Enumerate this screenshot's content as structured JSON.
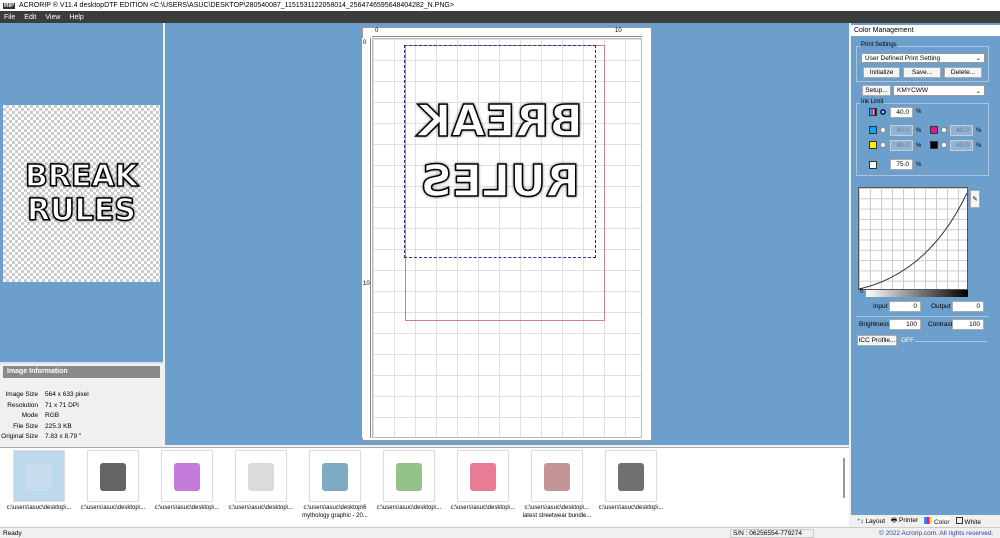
{
  "title": "ACRORIP ® V11.4 desktopDTF EDITION <C:\\USERS\\ASUC\\DESKTOP\\280540087_1151531122058014_2564746595648404282_N.PNG>",
  "menu": [
    "File",
    "Edit",
    "View",
    "Help"
  ],
  "artwork": {
    "line1": "BREAK",
    "line2": "RULES"
  },
  "image_info": {
    "header": "Image Information",
    "rows": [
      {
        "k": "Image Size",
        "v": "564 x 633 pixel"
      },
      {
        "k": "Resolution",
        "v": "71 x 71 DPI"
      },
      {
        "k": "Mode",
        "v": "RGB"
      },
      {
        "k": "File Size",
        "v": "225.3 KB"
      },
      {
        "k": "Original Size",
        "v": "7.83 x 8.79 \""
      }
    ]
  },
  "ruler": {
    "h0": "0",
    "h10": "10",
    "v0": "0",
    "v10": "10"
  },
  "color_mgmt": {
    "title": "Color Management",
    "print_settings": "Print Settings",
    "setting": "User Defined Print Setting",
    "initialize": "Initialize",
    "save": "Save...",
    "delete": "Delete...",
    "setup": "Setup...",
    "channel": "KMYCWW",
    "ink_limit": "Ink Limit",
    "total": "40.0",
    "c": "40.0",
    "m": "40.0",
    "y": "40.0",
    "k": "40.0",
    "white": "75.0",
    "pct": "%",
    "input_label": "Input",
    "input": "0",
    "output_label": "Output",
    "output": "0",
    "brightness_label": "Brightness",
    "brightness": "100",
    "contrast_label": "Contrast",
    "contrast": "100",
    "icc": "ICC Profile...",
    "icc_state": "OFF",
    "curve_zero": "0"
  },
  "tabs": [
    "Layout",
    "Printer",
    "Color",
    "White"
  ],
  "thumbnails": [
    {
      "l1": "c:\\users\\asuc\\desktop\\...",
      "l2": ""
    },
    {
      "l1": "c:\\users\\asuc\\desktop\\...",
      "l2": ""
    },
    {
      "l1": "c:\\users\\asuc\\desktop\\...",
      "l2": ""
    },
    {
      "l1": "c:\\users\\asuc\\desktop\\...",
      "l2": ""
    },
    {
      "l1": "c:\\users\\asuc\\desktop\\6",
      "l2": "mythology graphic - 20..."
    },
    {
      "l1": "c:\\users\\asuc\\desktop\\...",
      "l2": ""
    },
    {
      "l1": "c:\\users\\asuc\\desktop\\...",
      "l2": ""
    },
    {
      "l1": "c:\\users\\asuc\\desktop\\...",
      "l2": "latest streetwear bundle..."
    },
    {
      "l1": "c:\\users\\asuc\\desktop\\...",
      "l2": ""
    }
  ],
  "status": {
    "ready": "Ready",
    "serial": "S/N : 06256554-779274",
    "copyright": "© 2022 Acrorip.com. All rights reserved."
  }
}
